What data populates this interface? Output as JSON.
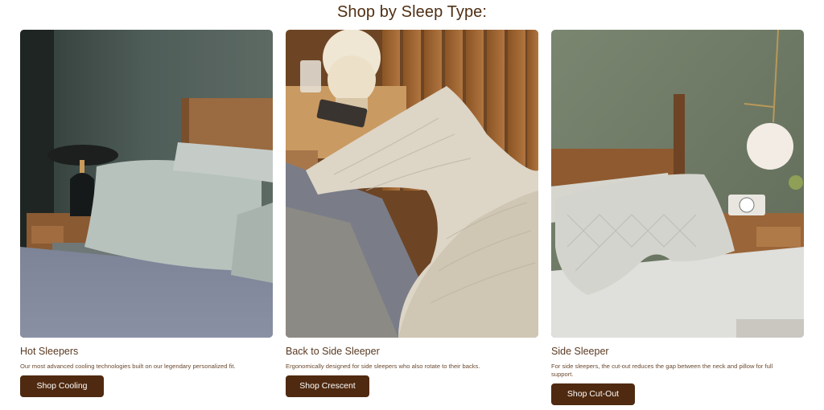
{
  "section": {
    "title": "Shop by Sleep Type:"
  },
  "cards": [
    {
      "title": "Hot Sleepers",
      "description": "Our most advanced cooling technologies built on our legendary personalized fit.",
      "button_label": "Shop Cooling",
      "image_alt": "bedroom with cooling pillow and dark lamp"
    },
    {
      "title": "Back to Side Sleeper",
      "description": "Ergonomically designed for side sleepers who also rotate to their backs.",
      "button_label": "Shop Crescent",
      "image_alt": "crescent shaped quilted pillow on bed"
    },
    {
      "title": "Side Sleeper",
      "description": "For side sleepers, the cut-out reduces the gap between the neck and pillow for full support.",
      "button_label": "Shop Cut-Out",
      "image_alt": "cut-out pillow on bed with globe lamp"
    }
  ]
}
